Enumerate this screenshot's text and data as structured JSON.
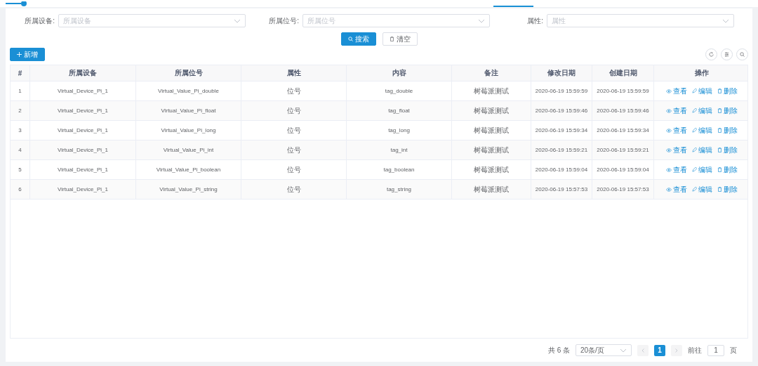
{
  "filters": [
    {
      "label": "所属设备:",
      "placeholder": "所属设备"
    },
    {
      "label": "所属位号:",
      "placeholder": "所属位号"
    },
    {
      "label": "属性:",
      "placeholder": "属性"
    }
  ],
  "search_button": "搜索",
  "clear_button": "清空",
  "add_button": "新增",
  "table": {
    "columns": [
      "#",
      "所属设备",
      "所属位号",
      "属性",
      "内容",
      "备注",
      "修改日期",
      "创建日期",
      "操作"
    ],
    "rows": [
      {
        "cells": [
          "1",
          "Virtual_Device_Pi_1",
          "Virtual_Value_Pi_double",
          "位号",
          "tag_double",
          "树莓派测试",
          "2020-06-19 15:59:59",
          "2020-06-19 15:59:59"
        ],
        "actions": [
          "查看",
          "编辑",
          "删除"
        ]
      },
      {
        "cells": [
          "2",
          "Virtual_Device_Pi_1",
          "Virtual_Value_Pi_float",
          "位号",
          "tag_float",
          "树莓派测试",
          "2020-06-19 15:59:46",
          "2020-06-19 15:59:46"
        ],
        "actions": [
          "查看",
          "编辑",
          "删除"
        ]
      },
      {
        "cells": [
          "3",
          "Virtual_Device_Pi_1",
          "Virtual_Value_Pi_long",
          "位号",
          "tag_long",
          "树莓派测试",
          "2020-06-19 15:59:34",
          "2020-06-19 15:59:34"
        ],
        "actions": [
          "查看",
          "编辑",
          "删除"
        ]
      },
      {
        "cells": [
          "4",
          "Virtual_Device_Pi_1",
          "Virtual_Value_Pi_int",
          "位号",
          "tag_int",
          "树莓派测试",
          "2020-06-19 15:59:21",
          "2020-06-19 15:59:21"
        ],
        "actions": [
          "查看",
          "编辑",
          "删除"
        ]
      },
      {
        "cells": [
          "5",
          "Virtual_Device_Pi_1",
          "Virtual_Value_Pi_boolean",
          "位号",
          "tag_boolean",
          "树莓派测试",
          "2020-06-19 15:59:04",
          "2020-06-19 15:59:04"
        ],
        "actions": [
          "查看",
          "编辑",
          "删除"
        ]
      },
      {
        "cells": [
          "6",
          "Virtual_Device_Pi_1",
          "Virtual_Value_Pi_string",
          "位号",
          "tag_string",
          "树莓派测试",
          "2020-06-19 15:57:53",
          "2020-06-19 15:57:53"
        ],
        "actions": [
          "查看",
          "编辑",
          "删除"
        ]
      }
    ]
  },
  "pagination": {
    "total": "共 6 条",
    "page_size": "20条/页",
    "pages": [
      {
        "label": "1",
        "selected": true
      }
    ],
    "goto_label": "前往",
    "goto_value": "1",
    "page_unit": "页"
  }
}
